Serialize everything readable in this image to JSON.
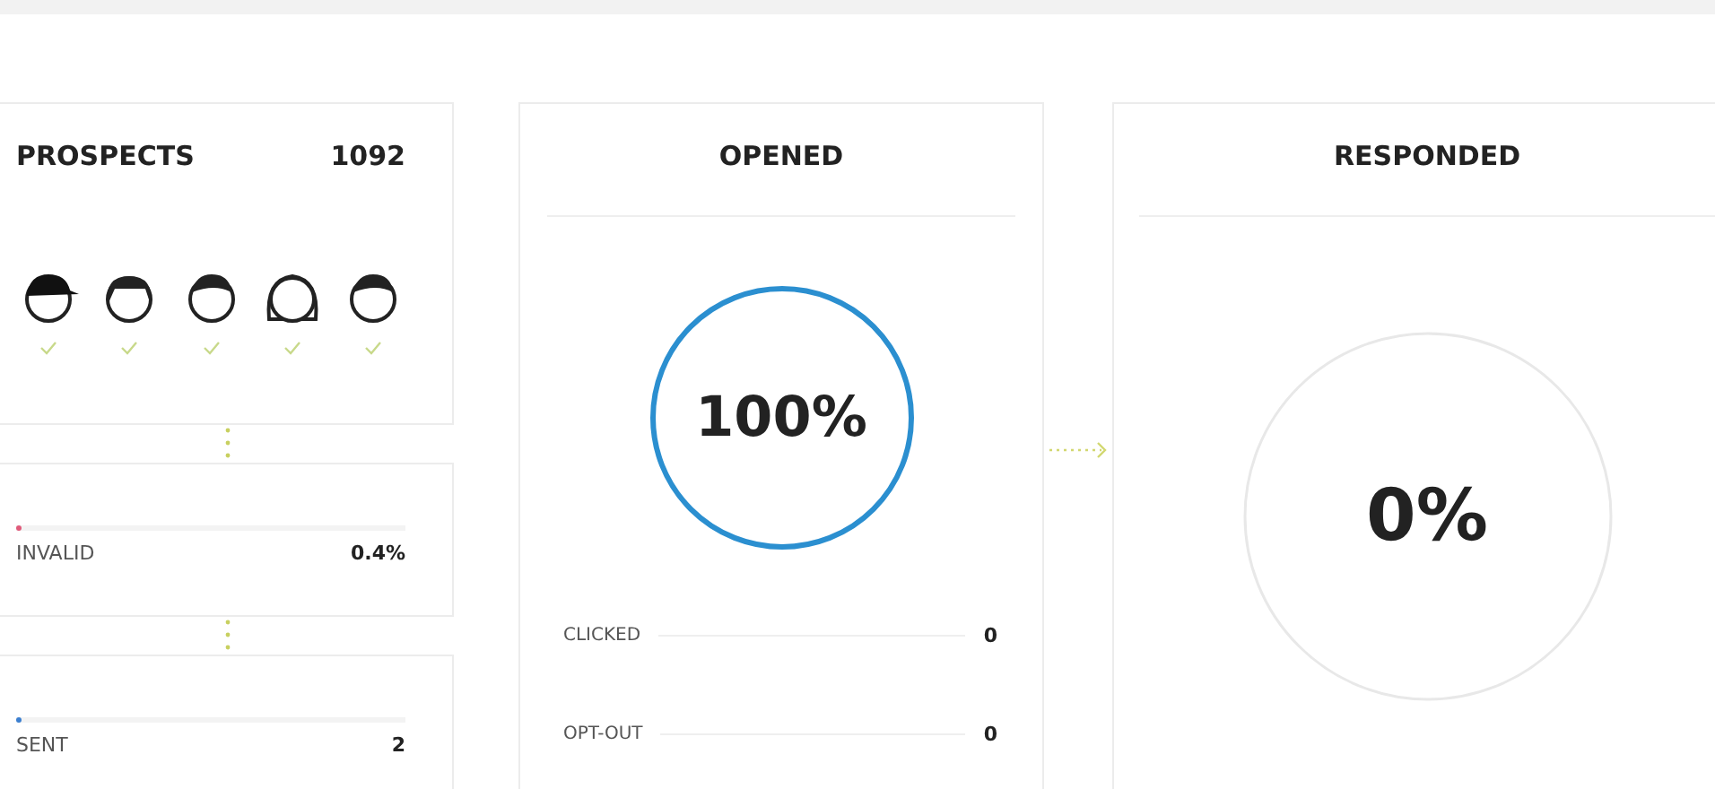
{
  "prospects": {
    "title": "PROSPECTS",
    "count": "1092",
    "avatars": [
      {
        "kind": "cap",
        "checked": true
      },
      {
        "kind": "bob",
        "checked": true
      },
      {
        "kind": "short",
        "checked": true
      },
      {
        "kind": "long",
        "checked": true
      },
      {
        "kind": "short",
        "checked": true
      }
    ]
  },
  "stats": [
    {
      "label": "INVALID",
      "value": "0.4%",
      "color": "#e05a7a",
      "level": 0.004
    },
    {
      "label": "SENT",
      "value": "2",
      "color": "#3b7fd0",
      "level": 0.002
    }
  ],
  "opened": {
    "title": "OPENED",
    "reading": "100%",
    "level": 1,
    "rows": [
      {
        "label": "CLICKED",
        "value": "0"
      },
      {
        "label": "OPT-OUT",
        "value": "0"
      }
    ]
  },
  "responded": {
    "title": "RESPONDED",
    "reading": "0%",
    "level": 0
  }
}
